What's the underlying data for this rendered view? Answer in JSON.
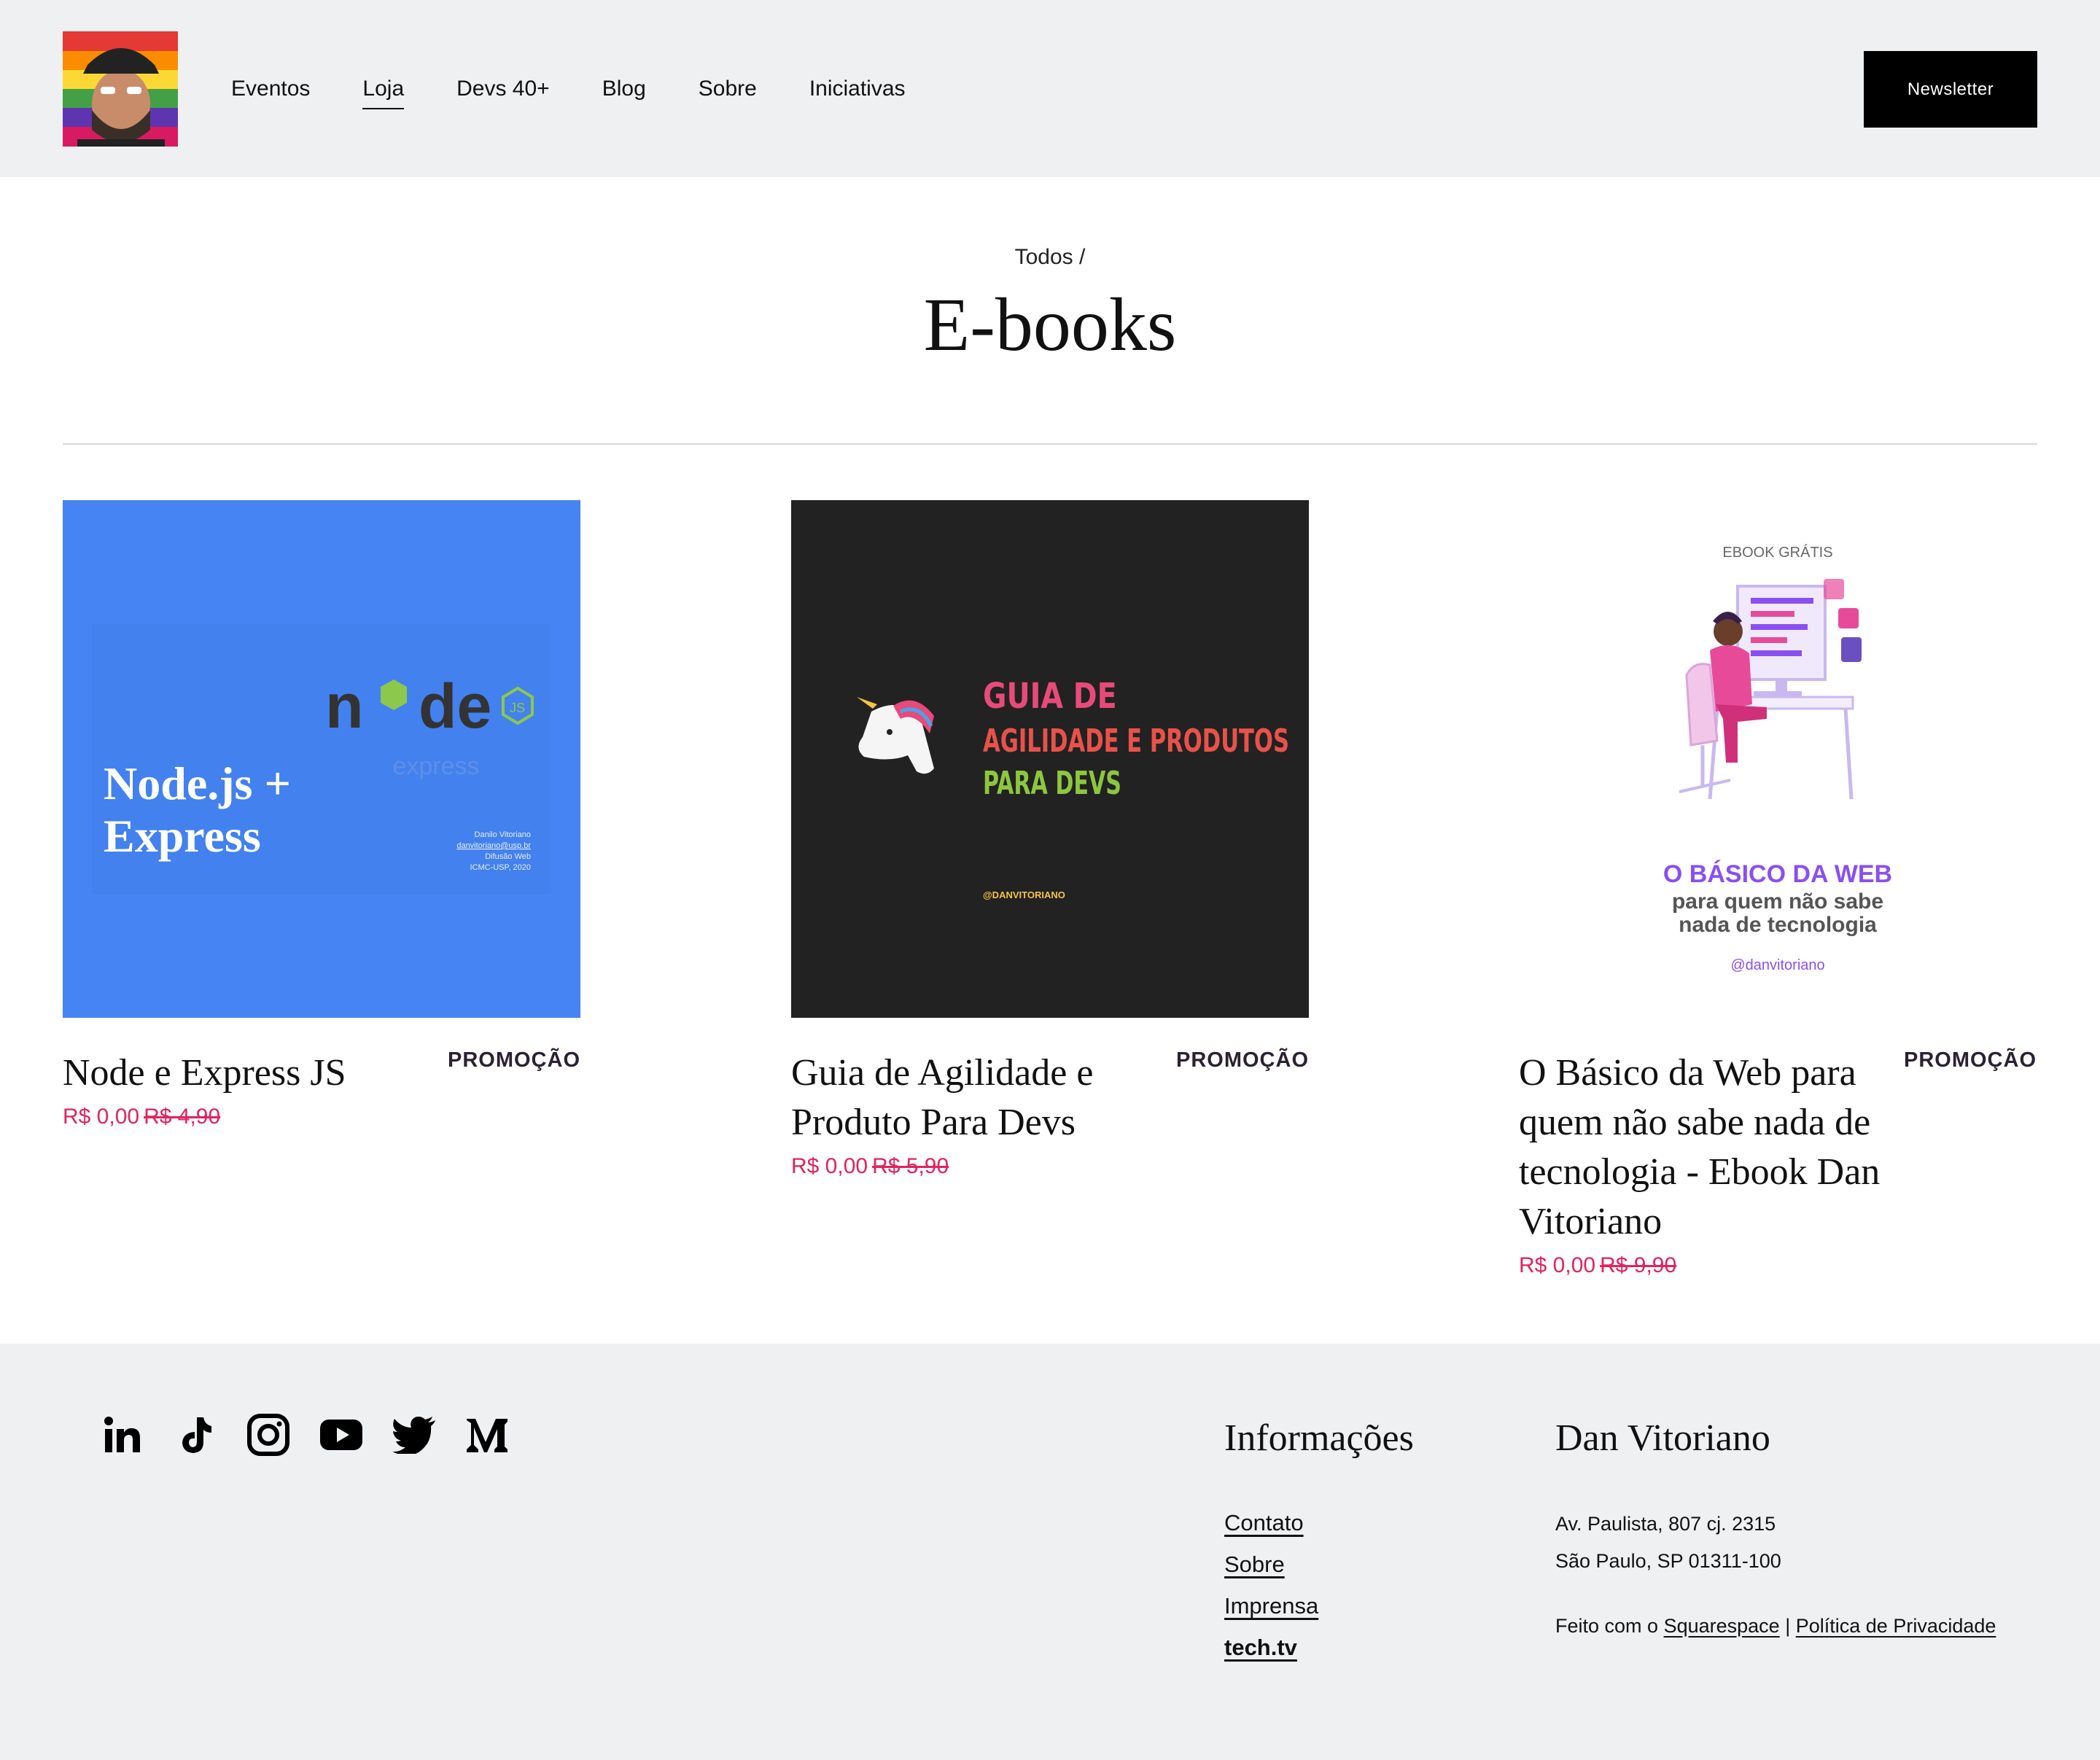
{
  "header": {
    "nav": [
      "Eventos",
      "Loja",
      "Devs 40+",
      "Blog",
      "Sobre",
      "Iniciativas"
    ],
    "active_nav": "Loja",
    "newsletter_label": "Newsletter"
  },
  "page": {
    "breadcrumb": "Todos /",
    "title": "E-books"
  },
  "products": [
    {
      "name": "Node e Express JS",
      "badge": "PROMOÇÃO",
      "price": "R$ 0,00",
      "old_price": "R$ 4,90",
      "thumb": {
        "bg": "#4684f3",
        "title_line1": "Node.js +",
        "title_line2": "Express",
        "logo_text": "express",
        "credit_lines": [
          "Danilo Vitoriano",
          "danvitoriano@usp.br",
          "Difusão Web",
          "ICMC-USP, 2020"
        ]
      }
    },
    {
      "name": "Guia de Agilidade e Produto Para Devs",
      "badge": "PROMOÇÃO",
      "price": "R$ 0,00",
      "old_price": "R$ 5,90",
      "thumb": {
        "bg": "#222222",
        "line1": "GUIA DE",
        "line2": "AGILIDADE E PRODUTOS",
        "line3": "PARA DEVS",
        "handle": "@DANVITORIANO"
      }
    },
    {
      "name": "O Básico da Web para quem não sabe nada de tecnologia - Ebook Dan Vitoriano",
      "badge": "PROMOÇÃO",
      "price": "R$ 0,00",
      "old_price": "R$ 9,90",
      "thumb": {
        "bg": "#ffffff",
        "top_label": "EBOOK GRÁTIS",
        "headline": "O BÁSICO DA WEB",
        "sub1": "para quem não sabe",
        "sub2": "nada de tecnologia",
        "handle": "@danvitoriano"
      }
    }
  ],
  "footer": {
    "social_icons": [
      "linkedin-icon",
      "tiktok-icon",
      "instagram-icon",
      "youtube-icon",
      "twitter-icon",
      "medium-icon"
    ],
    "info_title": "Informações",
    "links": [
      "Contato",
      "Sobre",
      "Imprensa",
      "tech.tv"
    ],
    "brand_title": "Dan Vitoriano",
    "address_line1": "Av. Paulista, 807 cj. 2315",
    "address_line2": "São Paulo, SP 01311-100",
    "made_prefix": "Feito com o",
    "squarespace": "Squarespace",
    "separator": "|",
    "privacy": "Política de Privacidade"
  },
  "colors": {
    "header_bg": "#eff0f2",
    "accent_price": "#e0245e",
    "node_thumb_bg": "#4684f3",
    "agile_thumb_bg": "#222222",
    "web_purple": "#8a4ff0"
  }
}
